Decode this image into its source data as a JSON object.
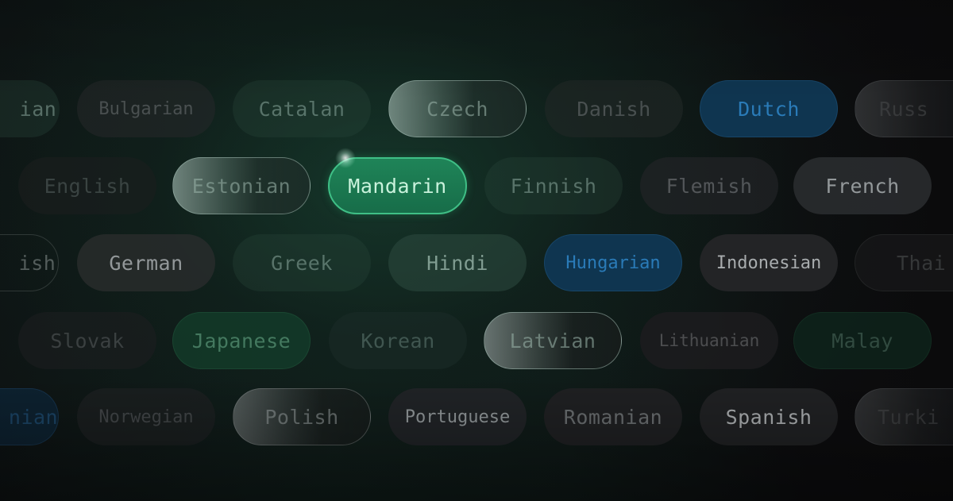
{
  "theme": {
    "active_color": "#1f8458",
    "active_border": "#3fbf86",
    "blue_accent": "#2a7bb8",
    "background": "#0c0d0e"
  },
  "rows": [
    {
      "chips": [
        {
          "label": "ian",
          "style": "partial-dim"
        },
        {
          "label": "Bulgarian",
          "style": "dim"
        },
        {
          "label": "Catalan",
          "style": "muted"
        },
        {
          "label": "Czech",
          "style": "glass"
        },
        {
          "label": "Danish",
          "style": "dim"
        },
        {
          "label": "Dutch",
          "style": "blue"
        },
        {
          "label": "Russ",
          "style": "glass-faded"
        }
      ]
    },
    {
      "chips": [
        {
          "label": "English",
          "style": "dark"
        },
        {
          "label": "Estonian",
          "style": "glass"
        },
        {
          "label": "Mandarin",
          "style": "active"
        },
        {
          "label": "Finnish",
          "style": "muted"
        },
        {
          "label": "Flemish",
          "style": "dark"
        },
        {
          "label": "French",
          "style": "grey"
        }
      ]
    },
    {
      "chips": [
        {
          "label": "ish",
          "style": "outline"
        },
        {
          "label": "German",
          "style": "grey"
        },
        {
          "label": "Greek",
          "style": "dim"
        },
        {
          "label": "Hindi",
          "style": "muted"
        },
        {
          "label": "Hungarian",
          "style": "blue"
        },
        {
          "label": "Indonesian",
          "style": "grey"
        },
        {
          "label": "Thai",
          "style": "faint"
        }
      ]
    },
    {
      "chips": [
        {
          "label": "Slovak",
          "style": "dark"
        },
        {
          "label": "Japanese",
          "style": "green-tint"
        },
        {
          "label": "Korean",
          "style": "dim"
        },
        {
          "label": "Latvian",
          "style": "glass"
        },
        {
          "label": "Lithuanian",
          "style": "dark"
        },
        {
          "label": "Malay",
          "style": "green-faint"
        }
      ]
    },
    {
      "chips": [
        {
          "label": "nian",
          "style": "blue-dim"
        },
        {
          "label": "Norwegian",
          "style": "dark"
        },
        {
          "label": "Polish",
          "style": "glass"
        },
        {
          "label": "Portuguese",
          "style": "grey"
        },
        {
          "label": "Romanian",
          "style": "grey"
        },
        {
          "label": "Spanish",
          "style": "grey-bright"
        },
        {
          "label": "Turki",
          "style": "glass-faded"
        }
      ]
    }
  ],
  "selected_language": "Mandarin"
}
